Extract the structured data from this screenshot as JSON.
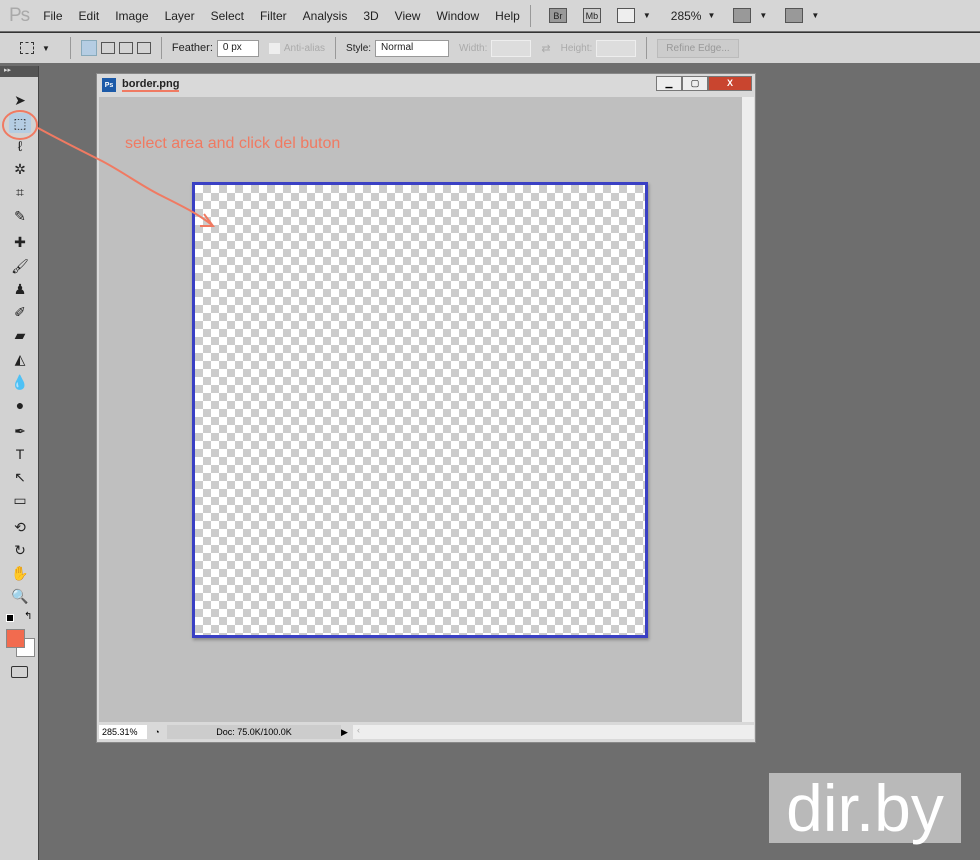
{
  "app": {
    "logo": "Ps"
  },
  "menu": [
    "File",
    "Edit",
    "Image",
    "Layer",
    "Select",
    "Filter",
    "Analysis",
    "3D",
    "View",
    "Window",
    "Help"
  ],
  "menubar_icons": {
    "bridge": "Br",
    "minibridge": "Mb",
    "zoom": "285%"
  },
  "options": {
    "feather_label": "Feather:",
    "feather_value": "0 px",
    "antialias": "Anti-alias",
    "style_label": "Style:",
    "style_value": "Normal",
    "width_label": "Width:",
    "height_label": "Height:",
    "refine": "Refine Edge..."
  },
  "tools": [
    "move-icon",
    "rect-marquee-icon",
    "lasso-icon",
    "magic-wand-icon",
    "crop-icon",
    "eyedropper-icon",
    "healing-brush-icon",
    "brush-icon",
    "clone-stamp-icon",
    "history-brush-icon",
    "eraser-icon",
    "paint-bucket-icon",
    "blur-icon",
    "dodge-icon",
    "pen-icon",
    "type-icon",
    "path-select-icon",
    "rectangle-icon",
    "3d-rotate-icon",
    "3d-orbit-icon",
    "hand-icon",
    "zoom-icon"
  ],
  "colors": {
    "foreground": "#f26b4f",
    "background": "#ffffff",
    "border": "#3a40c4",
    "annotation": "#f07a62"
  },
  "document": {
    "title": "border.png",
    "zoom": "285.31%",
    "doc_info": "Doc: 75.0K/100.0K"
  },
  "annotation": "select area and click del buton",
  "watermark": "dir.by"
}
